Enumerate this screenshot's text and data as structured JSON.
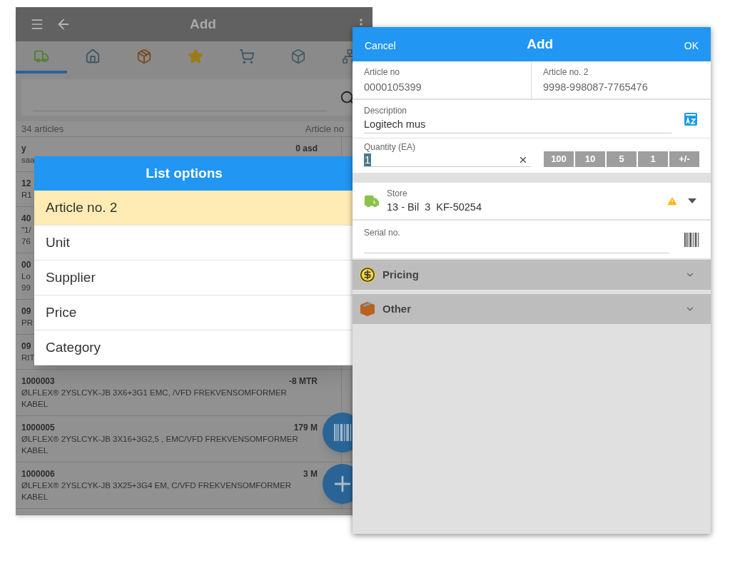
{
  "background_screen": {
    "title": "Add",
    "tabs": [
      {
        "kind": "truck",
        "selected": true
      },
      {
        "kind": "house",
        "selected": false
      },
      {
        "kind": "box",
        "selected": false
      },
      {
        "kind": "star",
        "selected": false
      },
      {
        "kind": "cart",
        "selected": false
      },
      {
        "kind": "cube",
        "selected": false
      },
      {
        "kind": "tree",
        "selected": false
      }
    ],
    "list_header": {
      "count": "34 articles",
      "sort": "Article no"
    },
    "rows": [
      {
        "number": "y",
        "lines": [
          "saa"
        ],
        "quantity": "0 asd"
      },
      {
        "number": "12",
        "lines": [
          "R1"
        ]
      },
      {
        "number": "40",
        "lines": [
          "\"1/",
          "76"
        ]
      },
      {
        "number": "00",
        "lines": [
          "Lo",
          "99"
        ]
      },
      {
        "number": "09",
        "lines": [
          "PR"
        ]
      },
      {
        "number": "09",
        "lines": [
          "RIT"
        ]
      },
      {
        "number": "1000003",
        "lines": [
          "ØLFLEX® 2YSLCYK-JB 3X6+3G1 EMC, /VFD FREKVENSOMFORMER KABEL"
        ],
        "quantity": "-8 MTR"
      },
      {
        "number": "1000005",
        "lines": [
          "ØLFLEX® 2YSLCYK-JB 3X16+3G2,5 , EMC/VFD FREKVENSOMFORMER KABEL"
        ],
        "quantity": "179 M"
      },
      {
        "number": "1000006",
        "lines": [
          "ØLFLEX® 2YSLCYK-JB 3X25+3G4 EM, C/VFD FREKVENSOMFORMER KABEL"
        ],
        "quantity": "3 M"
      }
    ]
  },
  "list_options": {
    "title": "List options",
    "options": [
      {
        "label": "Article no. 2",
        "selected": true
      },
      {
        "label": "Unit",
        "selected": false
      },
      {
        "label": "Supplier",
        "selected": false
      },
      {
        "label": "Price",
        "selected": false
      },
      {
        "label": "Category",
        "selected": false
      }
    ]
  },
  "add_dialog": {
    "cancel": "Cancel",
    "title": "Add",
    "ok": "OK",
    "article_no": {
      "label": "Article no",
      "value": "0000105399"
    },
    "article_no_2": {
      "label": "Article no. 2",
      "value": "9998-998087-7765476"
    },
    "description": {
      "label": "Description",
      "value": "Logitech mus"
    },
    "quantity": {
      "label": "Quantity (EA)",
      "value": "1",
      "steps": [
        "100",
        "10",
        "5",
        "1",
        "+/-"
      ]
    },
    "store": {
      "label": "Store",
      "value": "13 - Bil  3  KF-50254",
      "warning": true
    },
    "serial": {
      "label": "Serial no."
    },
    "sections": [
      {
        "kind": "pricing",
        "label": "Pricing",
        "expanded": false
      },
      {
        "kind": "other",
        "label": "Other",
        "expanded": false
      }
    ]
  }
}
